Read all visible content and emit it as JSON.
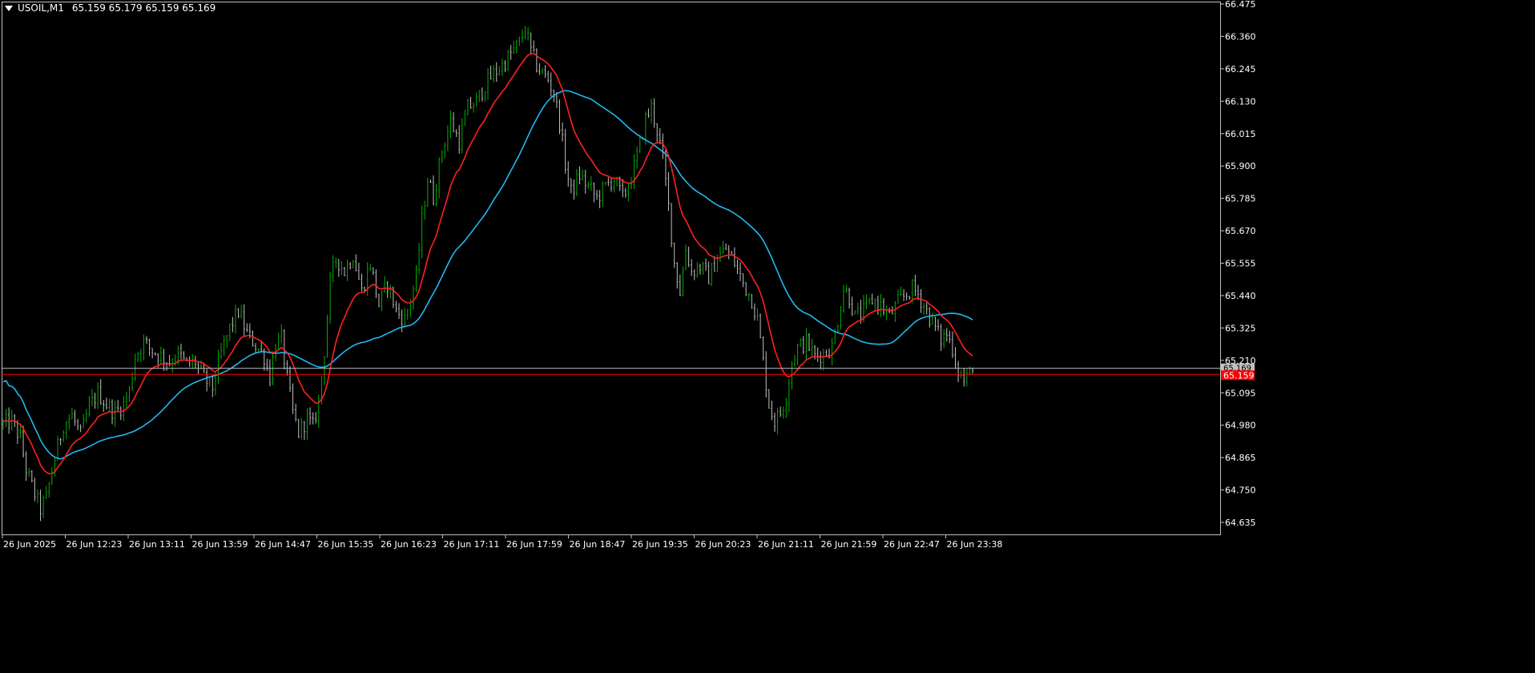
{
  "header": {
    "symbol_label": "USOIL,M1",
    "ohlc": "65.159 65.179 65.159 65.169"
  },
  "colors": {
    "background": "#000000",
    "frame": "#c0c0c0",
    "text": "#ffffff",
    "candle_up": "#00b000",
    "candle_down": "#c0c0c0",
    "ma_fast": "#ff2020",
    "ma_slow": "#20b8f0",
    "bid_line": "#ff0000",
    "ask_line": "#c0c0c0",
    "price_tag_bg": "#ff0000"
  },
  "chart_data": {
    "type": "line",
    "chart_kind": "candlestick with moving averages (M1)",
    "y_axis": {
      "ylim": [
        64.59,
        66.475
      ],
      "tick_labels": [
        "66.475",
        "66.360",
        "66.245",
        "66.130",
        "66.015",
        "65.900",
        "65.785",
        "65.670",
        "65.555",
        "65.440",
        "65.325",
        "65.210",
        "65.095",
        "64.980",
        "64.865",
        "64.750",
        "64.635"
      ]
    },
    "x_axis": {
      "tick_labels": [
        "26 Jun 2025",
        "26 Jun 12:23",
        "26 Jun 13:11",
        "26 Jun 13:59",
        "26 Jun 14:47",
        "26 Jun 15:35",
        "26 Jun 16:23",
        "26 Jun 17:11",
        "26 Jun 17:59",
        "26 Jun 18:47",
        "26 Jun 19:35",
        "26 Jun 20:23",
        "26 Jun 21:11",
        "26 Jun 21:59",
        "26 Jun 22:47",
        "26 Jun 23:38"
      ]
    },
    "price_path": [
      [
        0,
        64.98
      ],
      [
        3,
        64.99
      ],
      [
        6,
        64.93
      ],
      [
        8,
        64.82
      ],
      [
        10,
        64.76
      ],
      [
        13,
        64.68
      ],
      [
        15,
        64.72
      ],
      [
        18,
        64.86
      ],
      [
        21,
        64.98
      ],
      [
        24,
        65.01
      ],
      [
        27,
        64.94
      ],
      [
        30,
        65.04
      ],
      [
        33,
        65.09
      ],
      [
        36,
        65.05
      ],
      [
        39,
        65.02
      ],
      [
        42,
        65.05
      ],
      [
        44,
        65.1
      ],
      [
        46,
        65.22
      ],
      [
        49,
        65.27
      ],
      [
        52,
        65.24
      ],
      [
        55,
        65.22
      ],
      [
        58,
        65.2
      ],
      [
        61,
        65.23
      ],
      [
        64,
        65.19
      ],
      [
        67,
        65.2
      ],
      [
        70,
        65.14
      ],
      [
        73,
        65.11
      ],
      [
        76,
        65.23
      ],
      [
        79,
        65.32
      ],
      [
        82,
        65.38
      ],
      [
        85,
        65.3
      ],
      [
        88,
        65.26
      ],
      [
        91,
        65.22
      ],
      [
        93,
        65.15
      ],
      [
        95,
        65.27
      ],
      [
        97,
        65.28
      ],
      [
        99,
        65.14
      ],
      [
        101,
        65.02
      ],
      [
        103,
        64.95
      ],
      [
        106,
        65.0
      ],
      [
        108,
        64.97
      ],
      [
        110,
        65.06
      ],
      [
        112,
        65.24
      ],
      [
        114,
        65.48
      ],
      [
        116,
        65.57
      ],
      [
        119,
        65.52
      ],
      [
        122,
        65.58
      ],
      [
        125,
        65.45
      ],
      [
        128,
        65.55
      ],
      [
        131,
        65.4
      ],
      [
        134,
        65.48
      ],
      [
        137,
        65.38
      ],
      [
        140,
        65.35
      ],
      [
        142,
        65.42
      ],
      [
        144,
        65.5
      ],
      [
        146,
        65.7
      ],
      [
        148,
        65.85
      ],
      [
        150,
        65.78
      ],
      [
        153,
        65.95
      ],
      [
        156,
        66.05
      ],
      [
        159,
        65.98
      ],
      [
        162,
        66.1
      ],
      [
        165,
        66.12
      ],
      [
        168,
        66.18
      ],
      [
        171,
        66.22
      ],
      [
        174,
        66.25
      ],
      [
        177,
        66.29
      ],
      [
        180,
        66.33
      ],
      [
        182,
        66.38
      ],
      [
        184,
        66.3
      ],
      [
        186,
        66.25
      ],
      [
        188,
        66.22
      ],
      [
        190,
        66.2
      ],
      [
        192,
        66.15
      ],
      [
        194,
        66.05
      ],
      [
        196,
        65.9
      ],
      [
        198,
        65.8
      ],
      [
        201,
        65.86
      ],
      [
        204,
        65.82
      ],
      [
        207,
        65.78
      ],
      [
        210,
        65.82
      ],
      [
        213,
        65.85
      ],
      [
        216,
        65.78
      ],
      [
        219,
        65.85
      ],
      [
        222,
        65.97
      ],
      [
        224,
        66.06
      ],
      [
        226,
        66.1
      ],
      [
        228,
        66.02
      ],
      [
        230,
        65.92
      ],
      [
        232,
        65.75
      ],
      [
        234,
        65.55
      ],
      [
        236,
        65.45
      ],
      [
        238,
        65.6
      ],
      [
        240,
        65.52
      ],
      [
        243,
        65.54
      ],
      [
        246,
        65.5
      ],
      [
        249,
        65.57
      ],
      [
        252,
        65.6
      ],
      [
        255,
        65.55
      ],
      [
        258,
        65.48
      ],
      [
        261,
        65.42
      ],
      [
        263,
        65.35
      ],
      [
        265,
        65.2
      ],
      [
        267,
        65.05
      ],
      [
        269,
        64.99
      ],
      [
        271,
        65.02
      ],
      [
        273,
        65.08
      ],
      [
        275,
        65.2
      ],
      [
        277,
        65.25
      ],
      [
        280,
        65.27
      ],
      [
        283,
        65.22
      ],
      [
        286,
        65.23
      ],
      [
        289,
        65.25
      ],
      [
        291,
        65.35
      ],
      [
        293,
        65.46
      ],
      [
        295,
        65.43
      ],
      [
        297,
        65.36
      ],
      [
        300,
        65.38
      ],
      [
        303,
        65.42
      ],
      [
        306,
        65.4
      ],
      [
        309,
        65.36
      ],
      [
        312,
        65.41
      ],
      [
        315,
        65.44
      ],
      [
        317,
        65.46
      ],
      [
        319,
        65.44
      ],
      [
        321,
        65.4
      ],
      [
        323,
        65.36
      ],
      [
        325,
        65.32
      ],
      [
        327,
        65.28
      ],
      [
        329,
        65.3
      ],
      [
        331,
        65.25
      ],
      [
        333,
        65.17
      ],
      [
        335,
        65.13
      ],
      [
        337,
        65.16
      ],
      [
        338,
        65.169
      ]
    ],
    "series": [
      {
        "values": "fast moving average (red), computed from price_path"
      },
      {
        "values": "slow moving average (light blue), computed from price_path"
      }
    ],
    "bid_price": "65.159",
    "ask_price": "65.169",
    "grid": false,
    "legend": "none"
  }
}
